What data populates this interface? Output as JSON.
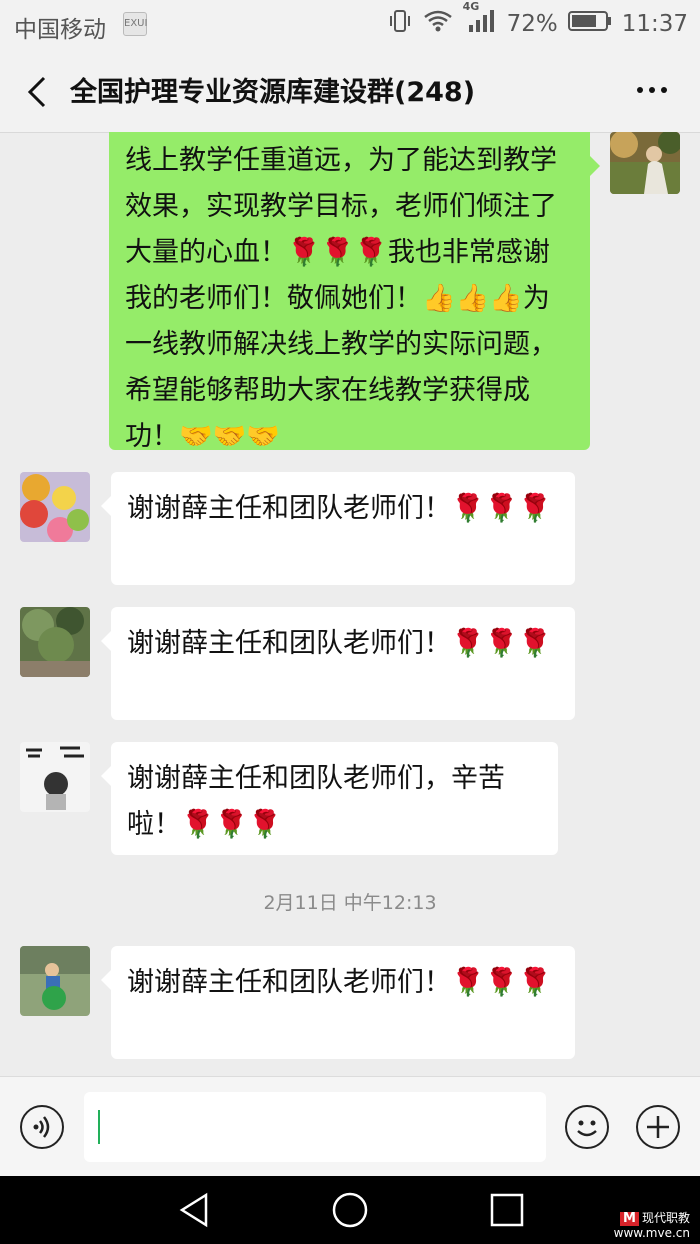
{
  "status_bar": {
    "carrier": "中国移动",
    "badge": "EXUI",
    "network": "4G",
    "battery": "72%",
    "time": "11:37"
  },
  "header": {
    "title": "全国护理专业资源库建设群(248)"
  },
  "messages": [
    {
      "side": "me",
      "text": "线上教学任重道远，为了能达到教学效果，实现教学目标，老师们倾注了大量的心血！🌹🌹🌹我也非常感谢我的老师们！敬佩她们！👍👍👍为一线教师解决线上教学的实际问题，希望能够帮助大家在线教学获得成功！🤝🤝🤝"
    },
    {
      "side": "other",
      "avatar": "macaron-avatar",
      "text": "谢谢薛主任和团队老师们！🌹🌹🌹"
    },
    {
      "side": "other",
      "avatar": "tree-avatar",
      "text": "谢谢薛主任和团队老师们！🌹🌹🌹"
    },
    {
      "side": "other",
      "avatar": "cartoon-avatar",
      "text": "谢谢薛主任和团队老师们，辛苦啦！🌹🌹🌹"
    },
    {
      "side": "other",
      "avatar": "child-avatar",
      "text": "谢谢薛主任和团队老师们！🌹🌹🌹"
    }
  ],
  "timestamp": "2月11日 中午12:13",
  "input": {
    "placeholder": ""
  },
  "watermark": {
    "logo": "M",
    "name": "现代职教",
    "url": "www.mve.cn"
  },
  "colors": {
    "my_bubble": "#95ec69",
    "other_bubble": "#ffffff",
    "background": "#ededed"
  },
  "icons": [
    "back-arrow-icon",
    "more-icon",
    "voice-icon",
    "emoji-icon",
    "plus-icon",
    "nav-back-icon",
    "nav-home-icon",
    "nav-recent-icon",
    "vibrate-icon",
    "wifi-icon",
    "signal-icon",
    "battery-icon"
  ]
}
